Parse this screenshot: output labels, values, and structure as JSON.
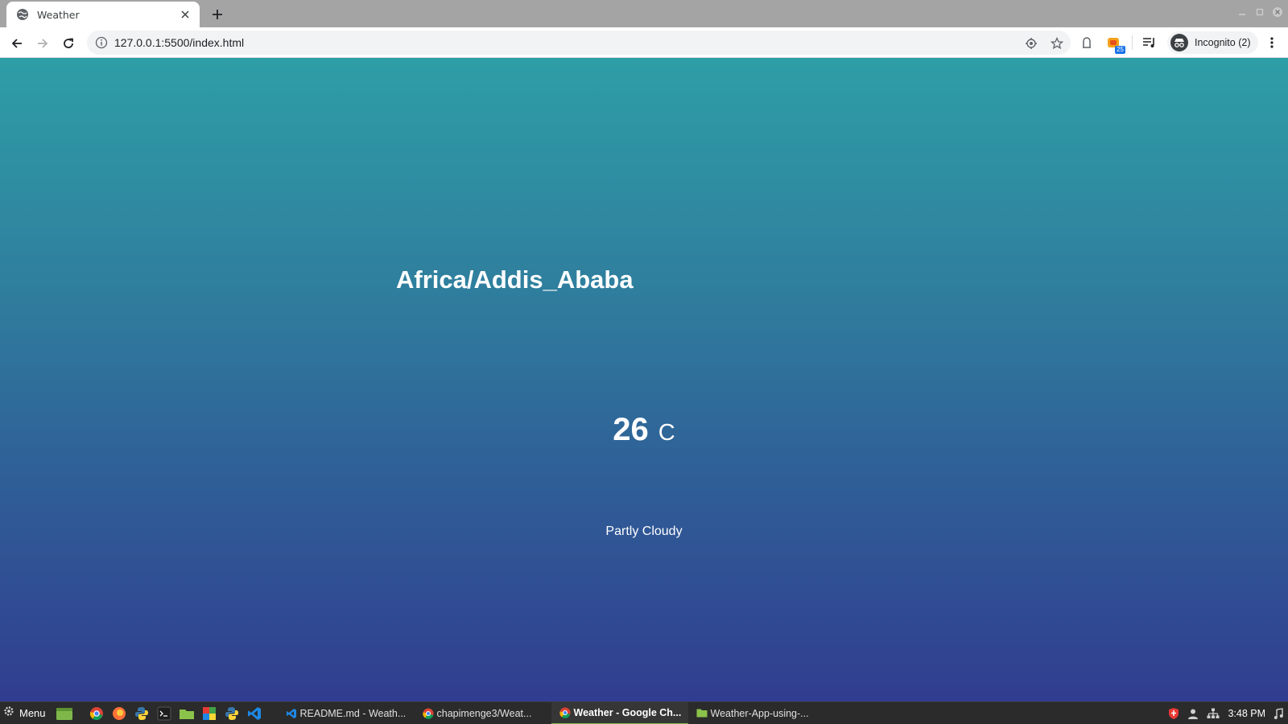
{
  "browser": {
    "tab": {
      "title": "Weather"
    },
    "address_bar": {
      "url": "127.0.0.1:5500/index.html"
    },
    "extension_badge": "25",
    "profile_label": "Incognito (2)"
  },
  "page": {
    "location": "Africa/Addis_Ababa",
    "temperature": "26",
    "unit": "C",
    "description": "Partly Cloudy"
  },
  "taskbar": {
    "menu_label": "Menu",
    "launchers": [
      "files-icon",
      "chrome-icon",
      "firefox-icon",
      "python-icon",
      "terminal-icon",
      "folder-icon",
      "office-icon",
      "python-icon",
      "vscode-icon"
    ],
    "windows": [
      {
        "label": "README.md - Weath...",
        "icon": "vscode-icon",
        "active": false
      },
      {
        "label": "chapimenge3/Weat...",
        "icon": "chrome-icon",
        "active": false
      },
      {
        "label": "Weather - Google Ch...",
        "icon": "chrome-icon",
        "active": true
      },
      {
        "label": "Weather-App-using-...",
        "icon": "folder-icon",
        "active": false
      }
    ],
    "clock": "3:48 PM"
  },
  "colors": {
    "gradient_top": "#2e9ea6",
    "gradient_bottom": "#313d90",
    "text": "#ffffff",
    "tabstrip": "#a4a4a4",
    "taskbar": "#2b2b2b"
  }
}
